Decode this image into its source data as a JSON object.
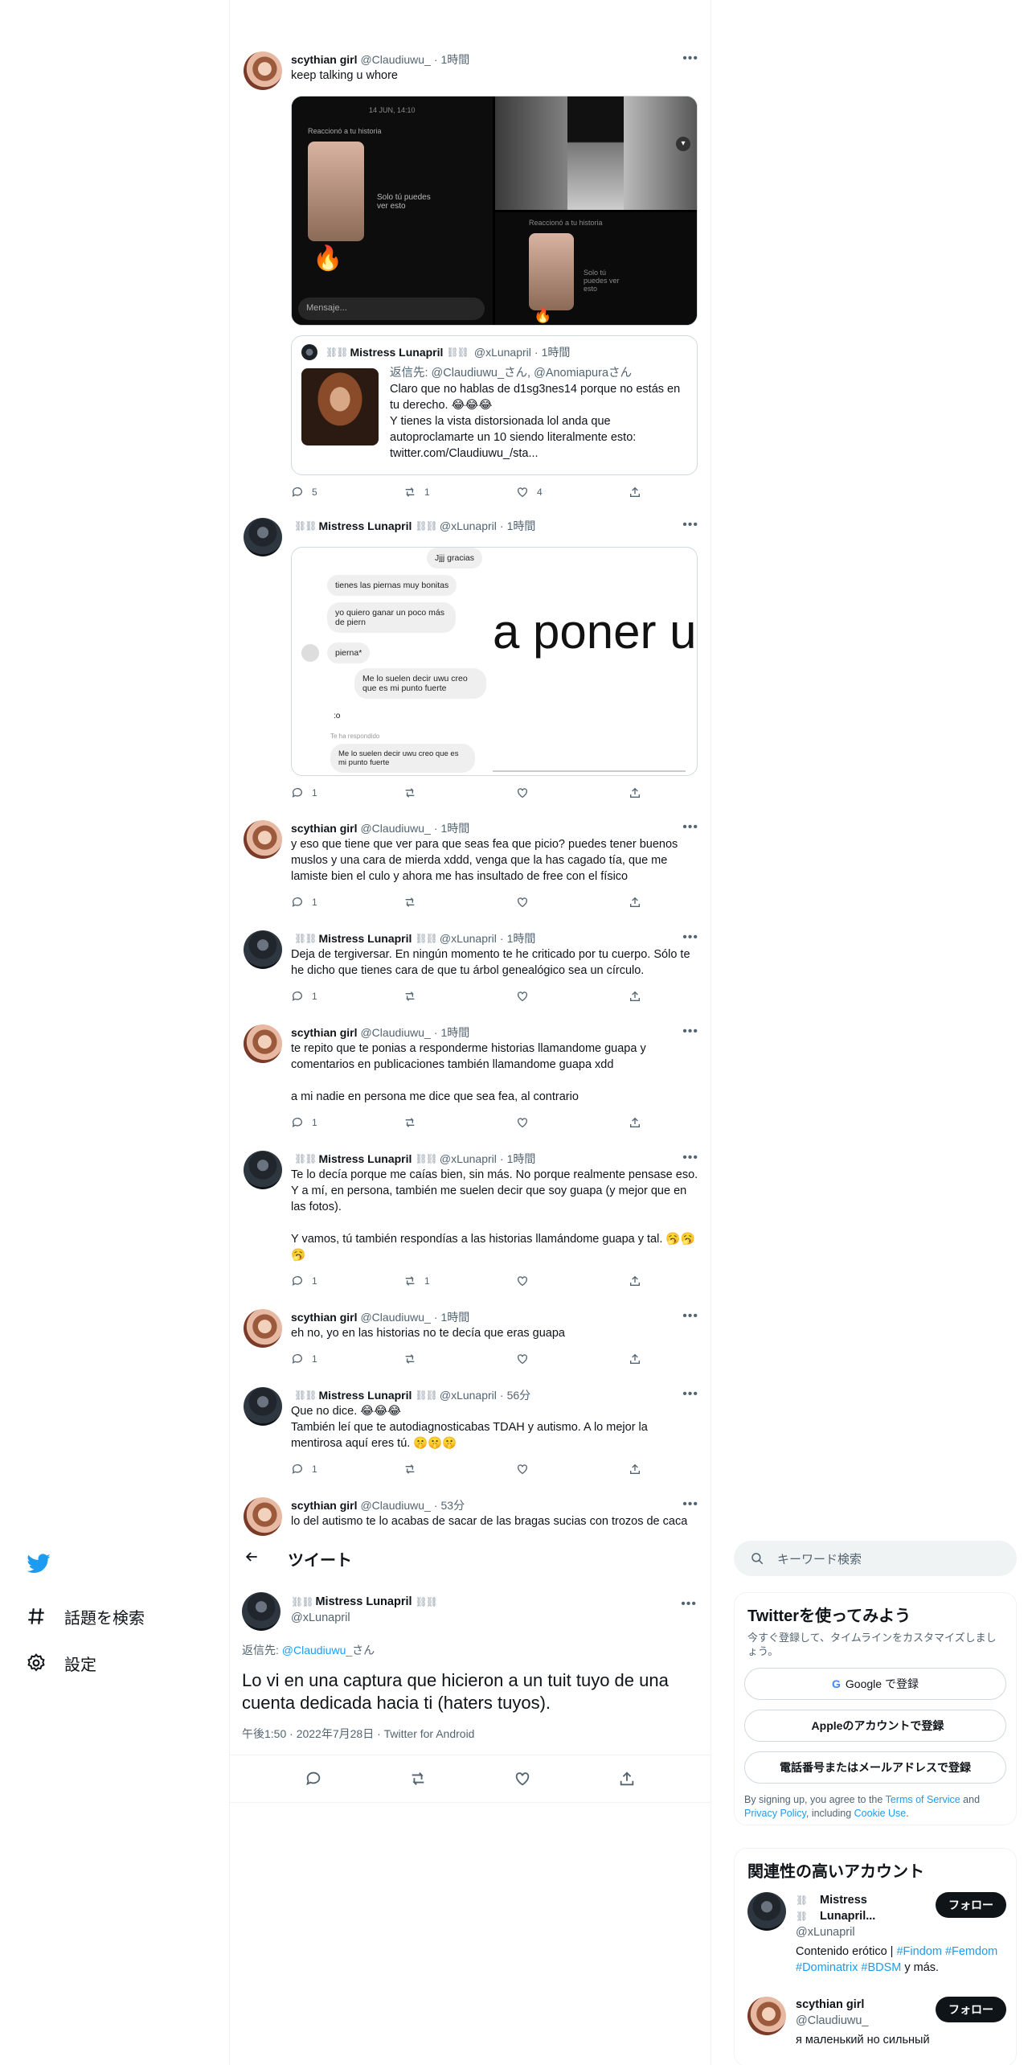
{
  "nav": {
    "logo_icon": "twitter-bird-icon",
    "explore_label": "話題を検索",
    "settings_label": "設定"
  },
  "timeline": [
    {
      "user": "scythian girl",
      "handle": "@Claudiuwu_",
      "time": "1時間",
      "text": "keep talking u whore",
      "media": {
        "date": "14 JUN, 14:10",
        "reacted": "Reaccionó a tu historia",
        "only_you": "Solo tú puedes ver esto",
        "message_placeholder": "Mensaje...",
        "reacted2": "Reaccionó a tu historia",
        "only_you2": "Solo tú puedes ver esto"
      },
      "quote": {
        "user": "Mistress Lunapril",
        "handle": "@xLunapril",
        "time": "1時間",
        "reply_to": "返信先: @Claudiuwu_さん, @Anomiapuraさん",
        "text1": "Claro que no hablas de d1sg3nes14 porque no estás en tu derecho. 😂😂😂",
        "text2": "Y tienes la vista distorsionada lol anda que autoproclamarte un 10 siendo literalmente esto: twitter.com/Claudiuwu_/sta..."
      },
      "replies": "5",
      "retweets": "1",
      "likes": "4"
    },
    {
      "user": "Mistress Lunapril",
      "handle": "@xLunapril",
      "time": "1時間",
      "convo": {
        "b1": "Jjjj gracias",
        "b2": "tienes las piernas muy bonitas",
        "b3": "yo quiero ganar un poco más de piern",
        "b4": "pierna*",
        "b5": "Me lo suelen decir uwu creo que es mi punto fuerte",
        "b6": ":o",
        "b7": "Te ha respondido",
        "b8": "Me lo suelen decir uwu creo que es mi punto fuerte",
        "big": "a poner u"
      },
      "replies": "1",
      "retweets": "",
      "likes": ""
    },
    {
      "user": "scythian girl",
      "handle": "@Claudiuwu_",
      "time": "1時間",
      "text": "y eso que tiene que ver para que seas fea que picio? puedes tener buenos muslos y una cara de mierda xddd, venga que la has cagado tía, que me lamiste bien el culo y ahora me has insultado de free con el físico",
      "replies": "1",
      "retweets": "",
      "likes": ""
    },
    {
      "user": "Mistress Lunapril",
      "handle": "@xLunapril",
      "time": "1時間",
      "text": "Deja de tergiversar. En ningún momento te he criticado por tu cuerpo. Sólo te he dicho que tienes cara de que tu árbol genealógico sea un círculo.",
      "replies": "1",
      "retweets": "",
      "likes": ""
    },
    {
      "user": "scythian girl",
      "handle": "@Claudiuwu_",
      "time": "1時間",
      "text": "te repito que te ponias a responderme historias llamandome guapa y comentarios en publicaciones también llamandome guapa xdd\n\na mi nadie en persona me dice que sea fea, al contrario",
      "replies": "1",
      "retweets": "",
      "likes": ""
    },
    {
      "user": "Mistress Lunapril",
      "handle": "@xLunapril",
      "time": "1時間",
      "text": "Te lo decía porque me caías bien, sin más. No porque realmente pensase eso. Y a mí, en persona, también me suelen decir que soy guapa (y mejor que en las fotos).\n\nY vamos, tú también respondías a las historias llamándome guapa y tal. 🥱🥱🥱",
      "replies": "1",
      "retweets": "1",
      "likes": ""
    },
    {
      "user": "scythian girl",
      "handle": "@Claudiuwu_",
      "time": "1時間",
      "text": "eh no, yo en las historias no te decía que eras guapa",
      "replies": "1",
      "retweets": "",
      "likes": ""
    },
    {
      "user": "Mistress Lunapril",
      "handle": "@xLunapril",
      "time": "56分",
      "text": "Que no dice. 😂😂😂\nTambién leí que te autodiagnosticabas TDAH y autismo. A lo mejor la mentirosa aquí eres tú. 🤫🤫🤫",
      "replies": "1",
      "retweets": "",
      "likes": ""
    },
    {
      "user": "scythian girl",
      "handle": "@Claudiuwu_",
      "time": "53分",
      "text": "lo del autismo te lo acabas de sacar de las bragas sucias con trozos de caca"
    }
  ],
  "detail": {
    "title": "ツイート",
    "user": "Mistress Lunapril",
    "handle": "@xLunapril",
    "reply_prefix": "返信先:",
    "reply_handle": "@Claudiuwu_",
    "reply_suffix": "さん",
    "text": "Lo vi en una captura que hicieron a un tuit tuyo de una cuenta dedicada hacia ti (haters tuyos).",
    "meta": "午後1:50 · 2022年7月28日 · Twitter for Android"
  },
  "sidebar": {
    "search_placeholder": "キーワード検索",
    "signup": {
      "title": "Twitterを使ってみよう",
      "subtitle": "今すぐ登録して、タイムラインをカスタマイズしましょう。",
      "google": "Google で登録",
      "apple": "Appleのアカウントで登録",
      "phone": "電話番号またはメールアドレスで登録",
      "terms1": "By signing up, you agree to the ",
      "terms_link": "Terms of Service",
      "terms2": " and ",
      "privacy_link": "Privacy Policy",
      "terms3": ", including ",
      "cookie_link": "Cookie Use",
      "terms4": "."
    },
    "relevant": {
      "title": "関連性の高いアカウント",
      "accounts": [
        {
          "name": "Mistress Lunapril...",
          "handle": "@xLunapril",
          "bio_prefix": "Contenido erótico | ",
          "tags": [
            "#Findom",
            "#Femdom",
            "#Dominatrix",
            "#BDSM"
          ],
          "bio_suffix": " y más.",
          "follow": "フォロー"
        },
        {
          "name": "scythian girl",
          "handle": "@Claudiuwu_",
          "bio": "я маленький но сильный",
          "follow": "フォロー"
        }
      ]
    }
  }
}
